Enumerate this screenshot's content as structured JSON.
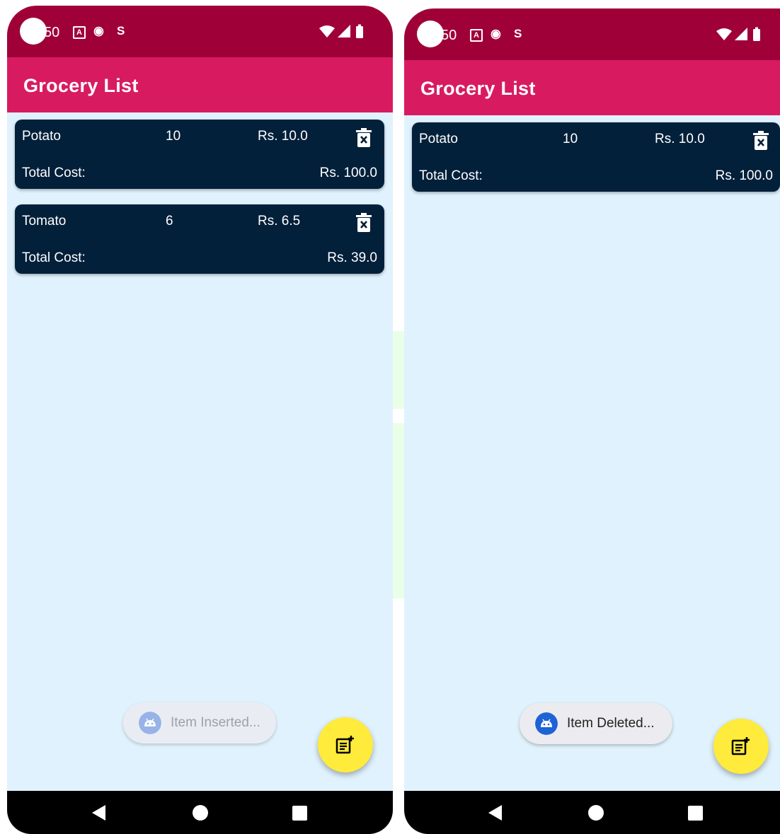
{
  "screens": [
    {
      "status": {
        "clock": "50"
      },
      "app_title": "Grocery List",
      "items": [
        {
          "name": "Potato",
          "qty": "10",
          "price": "Rs. 10.0",
          "total_label": "Total Cost:",
          "total": "Rs. 100.0"
        },
        {
          "name": "Tomato",
          "qty": "6",
          "price": "Rs. 6.5",
          "total_label": "Total Cost:",
          "total": "Rs. 39.0"
        }
      ],
      "toast": {
        "text": "Item Inserted..."
      }
    },
    {
      "status": {
        "clock": "50"
      },
      "app_title": "Grocery List",
      "items": [
        {
          "name": "Potato",
          "qty": "10",
          "price": "Rs. 10.0",
          "total_label": "Total Cost:",
          "total": "Rs. 100.0"
        }
      ],
      "toast": {
        "text": "Item Deleted..."
      }
    }
  ],
  "colors": {
    "status_bar": "#a00038",
    "app_bar": "#d81b60",
    "card": "#03203a",
    "background": "#e0f2fd",
    "fab": "#ffeb3b",
    "toast_icon": "#1e63d6"
  },
  "icons": {
    "delete": "delete-forever-icon",
    "fab": "note-add-icon",
    "toast": "android-icon"
  }
}
